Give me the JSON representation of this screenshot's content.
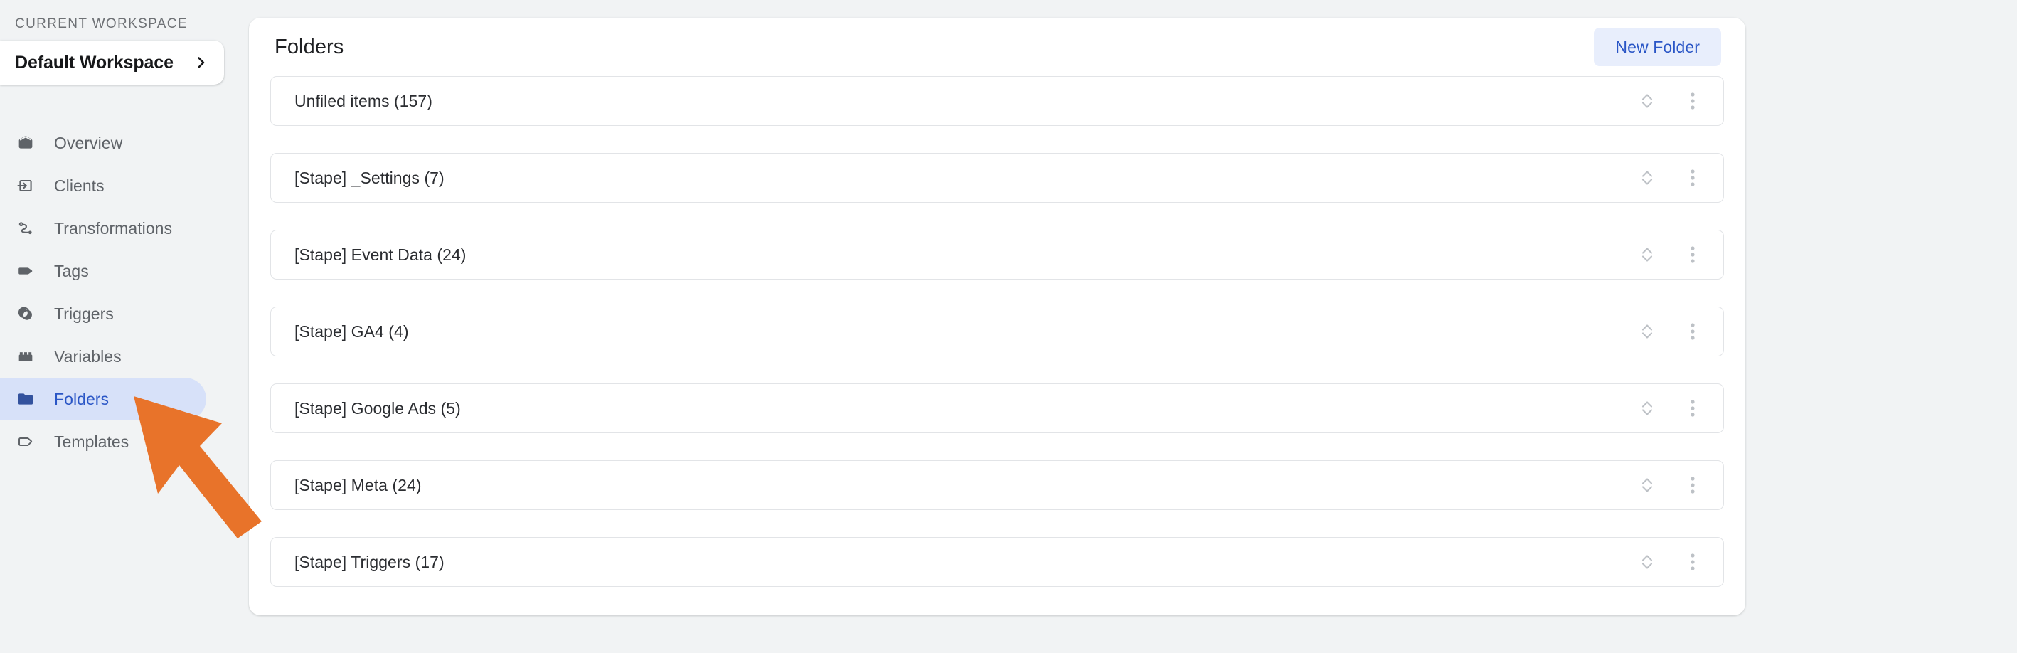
{
  "sidebar": {
    "workspace_label": "CURRENT WORKSPACE",
    "workspace_name": "Default Workspace",
    "workspace_chevron_icon": "chevron-right-icon",
    "items": [
      {
        "label": "Overview",
        "icon": "overview-box-icon",
        "active": false
      },
      {
        "label": "Clients",
        "icon": "client-login-icon",
        "active": false
      },
      {
        "label": "Transformations",
        "icon": "transformations-icon",
        "active": false
      },
      {
        "label": "Tags",
        "icon": "tag-filled-icon",
        "active": false
      },
      {
        "label": "Triggers",
        "icon": "trigger-circle-icon",
        "active": false
      },
      {
        "label": "Variables",
        "icon": "variables-block-icon",
        "active": false
      },
      {
        "label": "Folders",
        "icon": "folder-icon",
        "active": true
      },
      {
        "label": "Templates",
        "icon": "template-tag-icon",
        "active": false
      }
    ]
  },
  "main": {
    "title": "Folders",
    "new_folder_label": "New Folder",
    "row_sort_icon": "sort-updown-icon",
    "row_menu_icon": "more-vertical-icon",
    "folders": [
      {
        "name": "Unfiled items (157)"
      },
      {
        "name": "[Stape] _Settings (7)"
      },
      {
        "name": "[Stape] Event Data (24)"
      },
      {
        "name": "[Stape] GA4 (4)"
      },
      {
        "name": "[Stape] Google Ads (5)"
      },
      {
        "name": "[Stape] Meta (24)"
      },
      {
        "name": "[Stape] Triggers (17)"
      }
    ]
  },
  "annotation": {
    "arrow_icon": "orange-pointer-arrow",
    "arrow_color": "#E8732A"
  },
  "colors": {
    "page_background": "#F1F3F4",
    "panel_background": "#FFFFFF",
    "accent_blue": "#2A56C6",
    "active_pill": "#D7E1F9",
    "button_bg": "#E8EEFC",
    "row_border": "#E2E4E7",
    "nav_text": "#5F6368",
    "annotation_orange": "#E8732A"
  }
}
